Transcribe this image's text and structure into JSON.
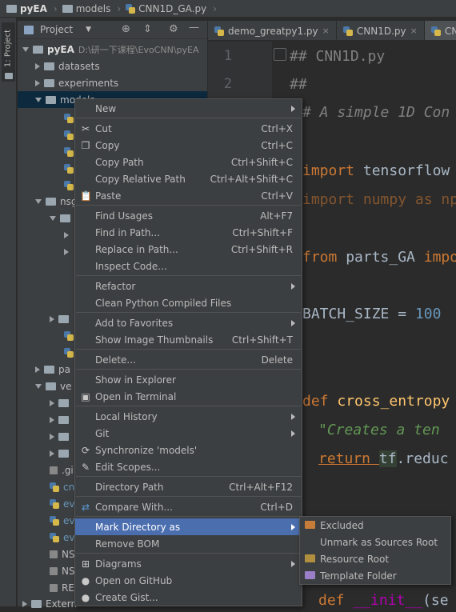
{
  "navbar": {
    "crumbs": [
      "pyEA",
      "models",
      "CNN1D_GA.py"
    ]
  },
  "stripe": {
    "label": "1: Project"
  },
  "project_panel": {
    "title": "Project"
  },
  "tree": {
    "root": {
      "name": "pyEA",
      "path": "D:\\研一下课程\\EvoCNN\\pyEA"
    },
    "items": [
      {
        "label": "datasets"
      },
      {
        "label": "experiments"
      },
      {
        "label": "models"
      },
      {
        "label": "nsg"
      },
      {
        "label": "pa"
      },
      {
        "label": "ve"
      },
      {
        "label": ".gi"
      },
      {
        "label": "cnn"
      },
      {
        "label": "eva"
      },
      {
        "label": "eva"
      },
      {
        "label": "evo"
      },
      {
        "label": "NS"
      },
      {
        "label": "NS"
      },
      {
        "label": "RE"
      },
      {
        "label": "Extern"
      }
    ]
  },
  "tabs": [
    {
      "label": "demo_greatpy1.py"
    },
    {
      "label": "CNN1D.py"
    },
    {
      "label": "CN"
    }
  ],
  "editor": {
    "line_numbers": [
      "1",
      "2"
    ],
    "lines": {
      "l1": "## CNN1D.py",
      "l2": "##",
      "l3": "# A simple 1D Con",
      "l4a": "import",
      "l4b": " tensorflow",
      "l5": "import numpy as np",
      "l6a": "from",
      "l6b": " parts_GA ",
      "l6c": "impo",
      "l7a": "BATCH_SIZE = ",
      "l7b": "100",
      "l8a": "def ",
      "l8b": "cross_entropy",
      "l9": "\"Creates a ten",
      "l10a": "return ",
      "l10b": "tf",
      "l10c": ".reduc",
      "l11a": "def ",
      "l11b": "__init__",
      "l11c": "(se"
    }
  },
  "menu": {
    "new": "New",
    "cut": "Cut",
    "cut_sc": "Ctrl+X",
    "copy": "Copy",
    "copy_sc": "Ctrl+C",
    "copy_path": "Copy Path",
    "copy_path_sc": "Ctrl+Shift+C",
    "copy_rel": "Copy Relative Path",
    "copy_rel_sc": "Ctrl+Alt+Shift+C",
    "paste": "Paste",
    "paste_sc": "Ctrl+V",
    "find_usages": "Find Usages",
    "find_usages_sc": "Alt+F7",
    "find_in_path": "Find in Path...",
    "find_in_path_sc": "Ctrl+Shift+F",
    "replace_in_path": "Replace in Path...",
    "replace_in_path_sc": "Ctrl+Shift+R",
    "inspect": "Inspect Code...",
    "refactor": "Refactor",
    "clean": "Clean Python Compiled Files",
    "favorites": "Add to Favorites",
    "thumbnails": "Show Image Thumbnails",
    "thumbnails_sc": "Ctrl+Shift+T",
    "delete": "Delete...",
    "delete_sc": "Delete",
    "explorer": "Show in Explorer",
    "terminal": "Open in Terminal",
    "local_history": "Local History",
    "git": "Git",
    "sync": "Synchronize 'models'",
    "scopes": "Edit Scopes...",
    "dir_path": "Directory Path",
    "dir_path_sc": "Ctrl+Alt+F12",
    "compare": "Compare With...",
    "compare_sc": "Ctrl+D",
    "mark_dir": "Mark Directory as",
    "remove_bom": "Remove BOM",
    "diagrams": "Diagrams",
    "github": "Open on GitHub",
    "gist": "Create Gist..."
  },
  "submenu": {
    "excluded": "Excluded",
    "unmark": "Unmark as Sources Root",
    "resource": "Resource Root",
    "template": "Template Folder"
  },
  "colors": {
    "selection": "#4b6eaf",
    "panel": "#3c3f41",
    "editor": "#2b2b2b"
  }
}
